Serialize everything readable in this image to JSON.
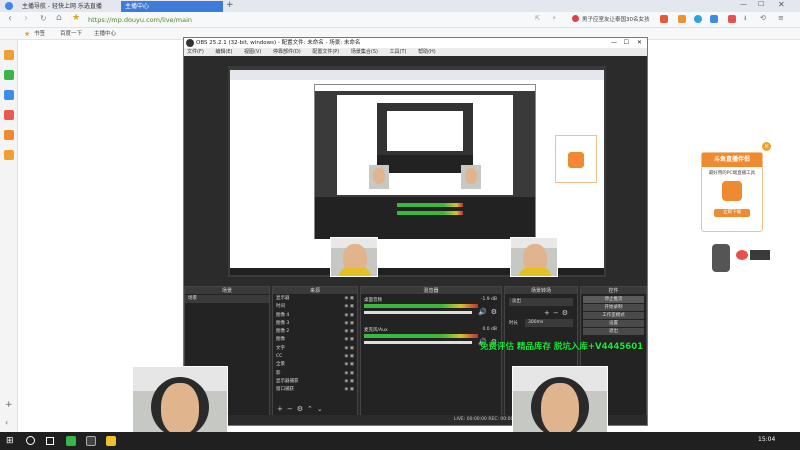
{
  "browser": {
    "tabs": [
      {
        "label": "主播导航 - 轻快上网 乐选直播"
      },
      {
        "label": "主播中心"
      }
    ],
    "url": "https://mp.douyu.com/live/main",
    "news_text": "男子应室友让泰国30名女孩",
    "bookmarks": [
      {
        "label": "书签"
      },
      {
        "label": "百度一下"
      },
      {
        "label": "主播中心"
      }
    ]
  },
  "obs": {
    "title": "OBS 25.2.1 (32-bit, windows) - 配置文件: 未命名 - 场景: 未命名",
    "menu": [
      "文件(F)",
      "编辑(E)",
      "视图(V)",
      "停靠部件(D)",
      "配置文件(P)",
      "场景集合(S)",
      "工具(T)",
      "帮助(H)"
    ],
    "docks": {
      "scenes": {
        "title": "场景",
        "items": [
          "场景"
        ]
      },
      "sources": {
        "title": "来源",
        "items": [
          "显示器",
          "时间",
          "图像 4",
          "图像 3",
          "图像 2",
          "图像",
          "文字",
          "CC",
          "全景",
          "影",
          "显示器捕获",
          "窗口捕获"
        ]
      },
      "mixer": {
        "title": "混音器",
        "channels": [
          {
            "name": "桌面音频",
            "db": "-1.9 dB"
          },
          {
            "name": "麦克风/Aux",
            "db": "0.0 dB"
          }
        ]
      },
      "transitions": {
        "title": "场景转场",
        "type": "淡出",
        "duration_label": "时长",
        "duration": "300ms"
      },
      "controls": {
        "title": "控件",
        "buttons": [
          "停止推流",
          "开始录制",
          "工作室模式",
          "设置",
          "退出"
        ]
      }
    },
    "status": "LIVE: 00:00:00   REC: 00:00:00   CPU"
  },
  "overlay": {
    "ad_title": "斗鱼直播伴侣",
    "ad_text": "最好用的PC端直播工具",
    "ad_button": "立即下载",
    "promo_text": "免费评估 精品库存 脱坑入库+V4445601"
  },
  "taskbar": {
    "time": "15:04"
  },
  "colors": {
    "accent": "#3e7ad9",
    "obs_bg": "#2b2b2b",
    "promo": "#1fe83c"
  }
}
